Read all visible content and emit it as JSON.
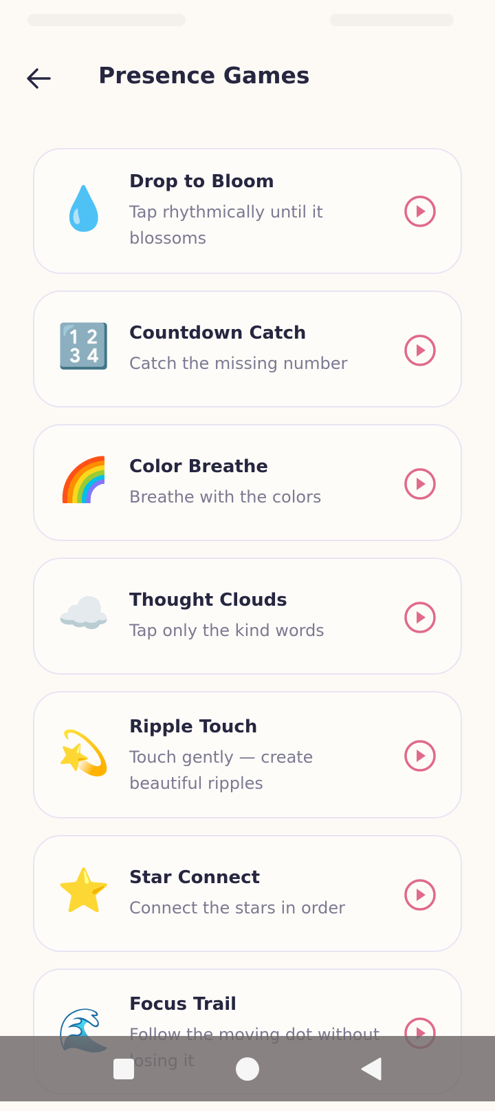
{
  "header": {
    "title": "Presence Games",
    "back_icon": "arrow-left-icon"
  },
  "games": [
    {
      "icon": "💧",
      "icon_name": "droplet-icon",
      "title": "Drop to Bloom",
      "description": "Tap rhythmically until it blossoms"
    },
    {
      "icon": "🔢",
      "icon_name": "numbers-1234-icon",
      "title": "Countdown Catch",
      "description": "Catch the missing number"
    },
    {
      "icon": "🌈",
      "icon_name": "rainbow-icon",
      "title": "Color Breathe",
      "description": "Breathe with the colors"
    },
    {
      "icon": "☁️",
      "icon_name": "cloud-icon",
      "title": "Thought Clouds",
      "description": "Tap only the kind words"
    },
    {
      "icon": "💫",
      "icon_name": "dizzy-star-icon",
      "title": "Ripple Touch",
      "description": "Touch gently — create beautiful ripples"
    },
    {
      "icon": "⭐",
      "icon_name": "star-icon",
      "title": "Star Connect",
      "description": "Connect the stars in order"
    },
    {
      "icon": "🌊",
      "icon_name": "wave-icon",
      "title": "Focus Trail",
      "description": "Follow the moving dot without losing it"
    }
  ],
  "colors": {
    "accent": "#e06a8a",
    "background": "#fdfaf6",
    "card_border": "#e8e4f4",
    "title_text": "#262640",
    "muted_text": "#7c7991"
  },
  "nav": {
    "recents_icon": "square-icon",
    "home_icon": "circle-icon",
    "back_icon": "triangle-back-icon"
  }
}
